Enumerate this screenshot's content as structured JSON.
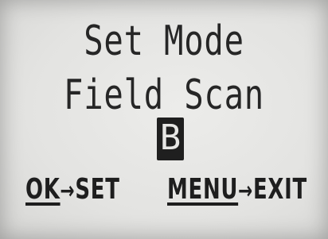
{
  "screen": {
    "title": "Set Mode",
    "mode_value": "Field Scan",
    "selected_option": "B"
  },
  "footer": {
    "ok_key": "OK",
    "ok_arrow": "→",
    "ok_action": "SET",
    "menu_key": "MENU",
    "menu_arrow": "→",
    "menu_action": "EXIT"
  },
  "colors": {
    "lcd_background": "#e7e7e5",
    "text": "#222222",
    "highlight": "#1f1f1f"
  }
}
